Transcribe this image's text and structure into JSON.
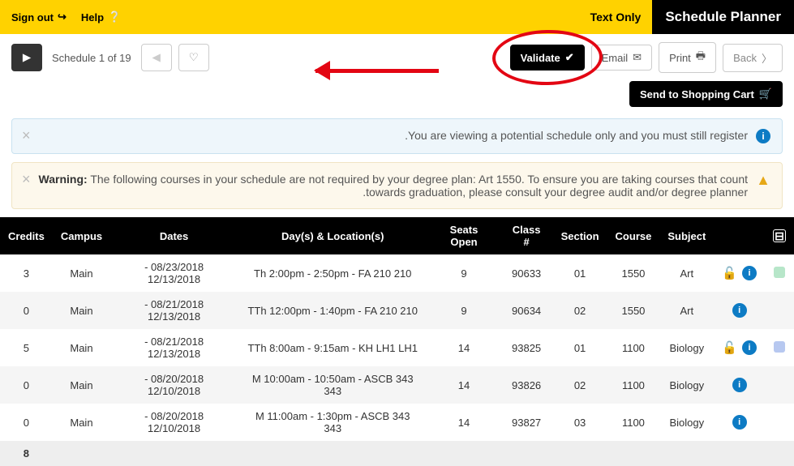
{
  "header": {
    "title": "Schedule Planner",
    "text_only": "Text Only",
    "help": "Help",
    "signout": "Sign out"
  },
  "toolbar": {
    "back": "Back",
    "print": "Print",
    "email": "Email",
    "validate": "Validate",
    "pager": "Schedule 1 of 19",
    "send_cart": "Send to Shopping Cart"
  },
  "alerts": {
    "info": "You are viewing a potential schedule only and you must still register.",
    "warn_label": "Warning:",
    "warn_text": " The following courses in your schedule are not required by your degree plan: Art 1550. To ensure you are taking courses that count towards graduation, please consult your degree audit and/or degree planner."
  },
  "table": {
    "headers": [
      "Subject",
      "Course",
      "Section",
      "Class #",
      "Seats Open",
      "Day(s) & Location(s)",
      "Dates",
      "Campus",
      "Credits"
    ],
    "rows": [
      {
        "swatch": "#b7e6c9",
        "lock": true,
        "subject": "Art",
        "course": "1550",
        "section": "01",
        "class": "90633",
        "seats": "9",
        "days": "Th 2:00pm - 2:50pm - FA 210 210",
        "dates": "08/23/2018 - 12/13/2018",
        "campus": "Main",
        "credits": "3"
      },
      {
        "swatch": "",
        "lock": false,
        "subject": "Art",
        "course": "1550",
        "section": "02",
        "class": "90634",
        "seats": "9",
        "days": "TTh 12:00pm - 1:40pm - FA 210 210",
        "dates": "08/21/2018 - 12/13/2018",
        "campus": "Main",
        "credits": "0"
      },
      {
        "swatch": "#b7c8f0",
        "lock": true,
        "subject": "Biology",
        "course": "1100",
        "section": "01",
        "class": "93825",
        "seats": "14",
        "days": "TTh 8:00am - 9:15am - KH LH1 LH1",
        "dates": "08/21/2018 - 12/13/2018",
        "campus": "Main",
        "credits": "5"
      },
      {
        "swatch": "",
        "lock": false,
        "subject": "Biology",
        "course": "1100",
        "section": "02",
        "class": "93826",
        "seats": "14",
        "days": "M 10:00am - 10:50am - ASCB 343 343",
        "dates": "08/20/2018 - 12/10/2018",
        "campus": "Main",
        "credits": "0"
      },
      {
        "swatch": "",
        "lock": false,
        "subject": "Biology",
        "course": "1100",
        "section": "03",
        "class": "93827",
        "seats": "14",
        "days": "M 11:00am - 1:30pm - ASCB 343 343",
        "dates": "08/20/2018 - 12/10/2018",
        "campus": "Main",
        "credits": "0"
      }
    ],
    "total_credits": "8"
  }
}
